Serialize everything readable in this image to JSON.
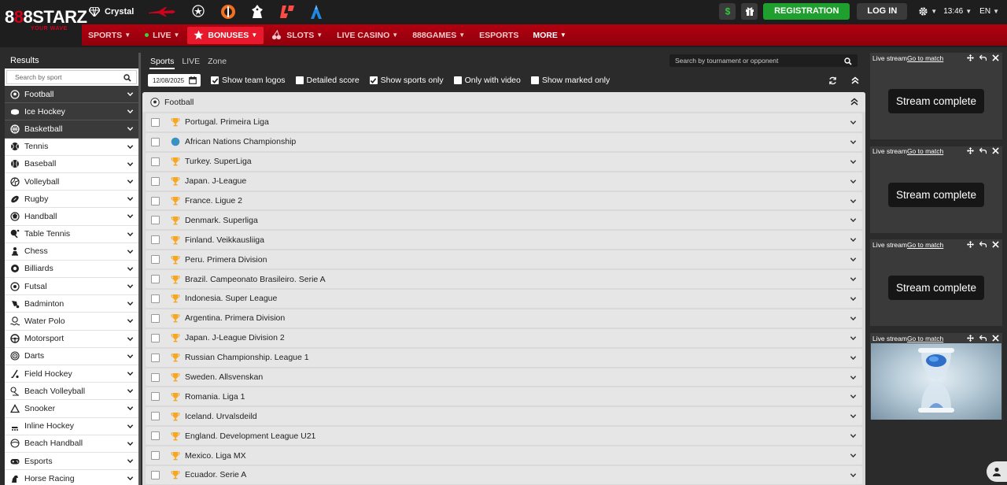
{
  "header": {
    "logo_main": "888STARZ",
    "logo_first": "8",
    "logo_red": "8",
    "logo_second": "8",
    "logo_rest": "STARZ",
    "logo_sub": "YOUR WAVE",
    "partner_crystal": "Crystal",
    "registration": "REGISTRATION",
    "login": "LOG IN",
    "time": "13:46",
    "language": "EN"
  },
  "nav": [
    {
      "label": "SPORTS"
    },
    {
      "label": "LIVE"
    },
    {
      "label": "BONUSES"
    },
    {
      "label": "SLOTS"
    },
    {
      "label": "LIVE CASINO"
    },
    {
      "label": "888GAMES"
    },
    {
      "label": "ESPORTS"
    },
    {
      "label": "MORE"
    }
  ],
  "sidebar": {
    "title": "Results",
    "search_placeholder": "Search by sport",
    "items": [
      {
        "label": "Football",
        "icon": "soccer-ball-icon"
      },
      {
        "label": "Ice Hockey",
        "icon": "hockey-puck-icon"
      },
      {
        "label": "Basketball",
        "icon": "basketball-icon"
      },
      {
        "label": "Tennis",
        "icon": "tennis-ball-icon"
      },
      {
        "label": "Baseball",
        "icon": "baseball-icon"
      },
      {
        "label": "Volleyball",
        "icon": "volleyball-icon"
      },
      {
        "label": "Rugby",
        "icon": "rugby-ball-icon"
      },
      {
        "label": "Handball",
        "icon": "handball-icon"
      },
      {
        "label": "Table Tennis",
        "icon": "ping-pong-icon"
      },
      {
        "label": "Chess",
        "icon": "chess-pawn-icon"
      },
      {
        "label": "Billiards",
        "icon": "billiard-ball-icon"
      },
      {
        "label": "Futsal",
        "icon": "futsal-ball-icon"
      },
      {
        "label": "Badminton",
        "icon": "shuttlecock-icon"
      },
      {
        "label": "Water Polo",
        "icon": "water-polo-icon"
      },
      {
        "label": "Motorsport",
        "icon": "steering-wheel-icon"
      },
      {
        "label": "Darts",
        "icon": "dartboard-icon"
      },
      {
        "label": "Field Hockey",
        "icon": "field-hockey-icon"
      },
      {
        "label": "Beach Volleyball",
        "icon": "beach-volleyball-icon"
      },
      {
        "label": "Snooker",
        "icon": "snooker-icon"
      },
      {
        "label": "Inline Hockey",
        "icon": "inline-hockey-icon"
      },
      {
        "label": "Beach Handball",
        "icon": "beach-handball-icon"
      },
      {
        "label": "Esports",
        "icon": "gamepad-icon"
      },
      {
        "label": "Horse Racing",
        "icon": "horse-icon"
      }
    ]
  },
  "main": {
    "tabs": [
      {
        "label": "Sports"
      },
      {
        "label": "LIVE"
      },
      {
        "label": "Zone"
      }
    ],
    "search_placeholder": "Search by tournament or opponent",
    "date": "12/08/2025",
    "filters": [
      {
        "label": "Show team logos",
        "checked": true
      },
      {
        "label": "Detailed score",
        "checked": false
      },
      {
        "label": "Show sports only",
        "checked": true
      },
      {
        "label": "Only with video",
        "checked": false
      },
      {
        "label": "Show marked only",
        "checked": false
      }
    ],
    "group_title": "Football",
    "leagues": [
      {
        "label": "Portugal. Primeira Liga",
        "icon": "trophy-icon"
      },
      {
        "label": "African Nations Championship",
        "icon": "globe-icon"
      },
      {
        "label": "Turkey. SuperLiga",
        "icon": "trophy-icon"
      },
      {
        "label": "Japan. J-League",
        "icon": "trophy-icon"
      },
      {
        "label": "France. Ligue 2",
        "icon": "trophy-icon"
      },
      {
        "label": "Denmark. Superliga",
        "icon": "trophy-icon"
      },
      {
        "label": "Finland. Veikkausliiga",
        "icon": "trophy-icon"
      },
      {
        "label": "Peru. Primera Division",
        "icon": "trophy-icon"
      },
      {
        "label": "Brazil. Campeonato Brasileiro. Serie A",
        "icon": "trophy-icon"
      },
      {
        "label": "Indonesia. Super League",
        "icon": "trophy-icon"
      },
      {
        "label": "Argentina. Primera Division",
        "icon": "trophy-icon"
      },
      {
        "label": "Japan. J-League Division 2",
        "icon": "trophy-icon"
      },
      {
        "label": "Russian Championship. League 1",
        "icon": "trophy-icon"
      },
      {
        "label": "Sweden. Allsvenskan",
        "icon": "trophy-icon"
      },
      {
        "label": "Romania. Liga 1",
        "icon": "trophy-icon"
      },
      {
        "label": "Iceland. Urvalsdeild",
        "icon": "trophy-icon"
      },
      {
        "label": "England. Development League U21",
        "icon": "trophy-icon"
      },
      {
        "label": "Mexico. Liga MX",
        "icon": "trophy-icon"
      },
      {
        "label": "Ecuador. Serie A",
        "icon": "trophy-icon"
      }
    ]
  },
  "streams": [
    {
      "title": "Live stream",
      "link": "Go to match",
      "status": "Stream complete"
    },
    {
      "title": "Live stream",
      "link": "Go to match",
      "status": "Stream complete"
    },
    {
      "title": "Live stream",
      "link": "Go to match",
      "status": "Stream complete"
    },
    {
      "title": "Live stream",
      "link": "Go to match",
      "status": ""
    }
  ],
  "colors": {
    "accent_red": "#d0021b",
    "nav_red": "#b30010",
    "nav_active": "#e8192c",
    "registration_green": "#1fa02e",
    "panel_dark": "#2b2b2b"
  }
}
